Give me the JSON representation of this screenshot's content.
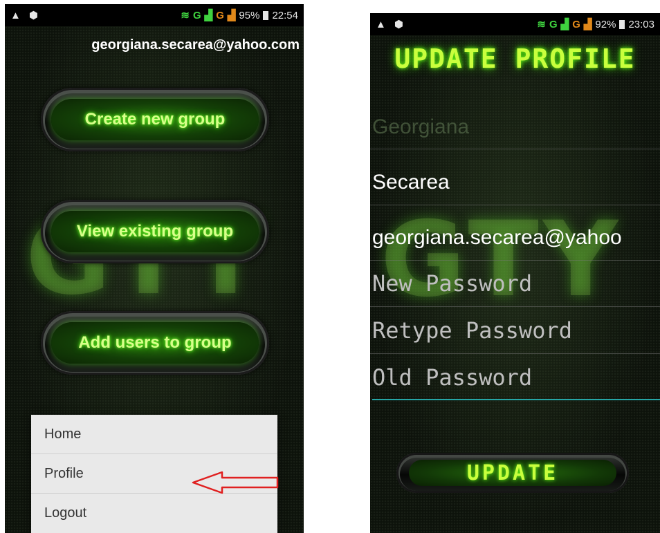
{
  "colors": {
    "glow_green": "#6dff2a",
    "title_green": "#c9ff3d",
    "accent_teal": "#26a6a6",
    "arrow_red": "#e02020",
    "menu_bg": "#e9e9e9"
  },
  "left_screen": {
    "status": {
      "battery": "95%",
      "time": "22:54",
      "net1": "G",
      "net2": "G",
      "icons": [
        "warning-icon",
        "shield-icon",
        "wifi-icon",
        "signal-icon",
        "battery-icon"
      ]
    },
    "account_email": "georgiana.secarea@yahoo.com",
    "buttons": [
      "Create new group",
      "View existing group",
      "Add users to group"
    ],
    "menu": [
      "Home",
      "Profile",
      "Logout"
    ]
  },
  "right_screen": {
    "status": {
      "battery": "92%",
      "time": "23:03",
      "net1": "G",
      "net2": "G"
    },
    "title": "UPDATE PROFILE",
    "fields": {
      "first_name": "Georgiana",
      "last_name": "Secarea",
      "email": "georgiana.secarea@yahoo",
      "new_password_placeholder": "New Password",
      "retype_password_placeholder": "Retype Password",
      "old_password_placeholder": "Old Password"
    },
    "update_label": "UPDATE"
  }
}
